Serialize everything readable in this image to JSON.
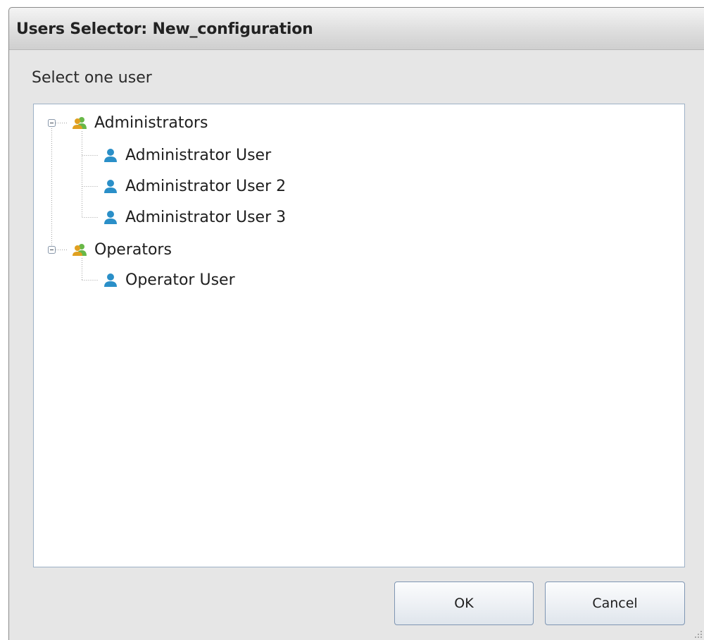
{
  "window": {
    "title": "Users Selector:  New_configuration"
  },
  "instruction": "Select one user",
  "tree": {
    "groups": [
      {
        "label": "Administrators",
        "icon": "user-group-icon",
        "expanded": true,
        "children": [
          {
            "label": "Administrator User",
            "icon": "user-icon"
          },
          {
            "label": "Administrator User 2",
            "icon": "user-icon"
          },
          {
            "label": "Administrator User 3",
            "icon": "user-icon"
          }
        ]
      },
      {
        "label": "Operators",
        "icon": "user-group-icon",
        "expanded": true,
        "children": [
          {
            "label": "Operator User",
            "icon": "user-icon"
          }
        ]
      }
    ]
  },
  "buttons": {
    "ok": "OK",
    "cancel": "Cancel"
  },
  "colors": {
    "user_icon": "#2a8fc8",
    "group_icon_front": "#e0a020",
    "group_icon_back": "#68b848",
    "tree_border": "#9db1c6"
  }
}
